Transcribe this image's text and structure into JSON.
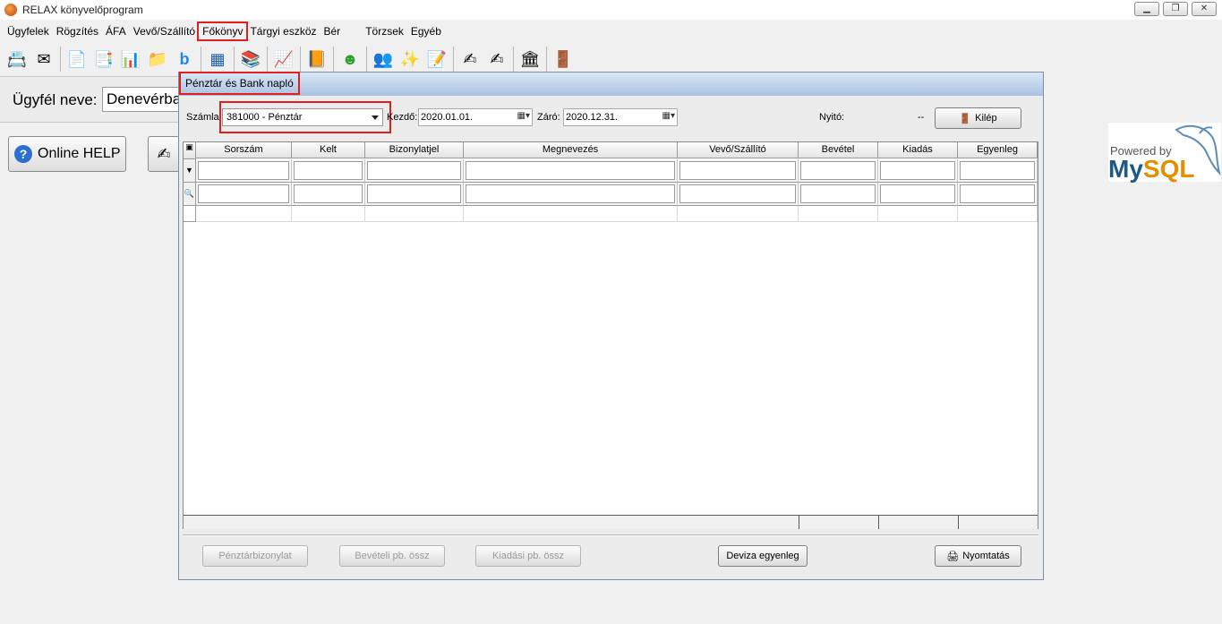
{
  "window": {
    "title": "RELAX könyvelőprogram",
    "minimize": "▁",
    "restore": "❐",
    "close": "✕"
  },
  "menu": {
    "items": [
      "Ügyfelek",
      "Rögzítés",
      "ÁFA",
      "Vevő/Szállító",
      "Főkönyv",
      "Tárgyi eszköz",
      "Bér",
      "Törzsek",
      "Egyéb"
    ]
  },
  "toolbar": {
    "icons": [
      "📇",
      "✉",
      "📄",
      "📑",
      "📊",
      "📁",
      "b",
      "▦",
      "📚",
      "📈",
      "📙",
      "☻",
      "👥",
      "✨",
      "📝",
      "✍",
      "✍",
      "🏛",
      "🚪"
    ]
  },
  "customer": {
    "label": "Ügyfél neve:",
    "value": "Denevérba"
  },
  "help": {
    "label": "Online HELP",
    "icon": "?"
  },
  "mysql": {
    "powered": "Powered by",
    "my": "My",
    "sql": "SQL"
  },
  "dialog": {
    "title": "Pénztár és Bank napló",
    "filters": {
      "account_label": "Számla",
      "account_value": "381000 - Pénztár",
      "start_label": "Kezdő:",
      "start_value": "2020.01.01.",
      "end_label": "Záró:",
      "end_value": "2020.12.31.",
      "opening_label": "Nyitó:",
      "opening_value": "--",
      "exit_label": "Kilép"
    },
    "grid": {
      "columns": [
        "Sorszám",
        "Kelt",
        "Bizonylatjel",
        "Megnevezés",
        "Vevő/Szállító",
        "Bevétel",
        "Kiadás",
        "Egyenleg"
      ],
      "filter_marker": "▼",
      "search_marker": "🔍",
      "corner_marker": "▣"
    },
    "buttons": {
      "cash_receipt": "Pénztárbizonylat",
      "income_total": "Bevételi pb. össz",
      "expense_total": "Kiadási pb. össz",
      "currency_balance": "Deviza egyenleg",
      "print": "Nyomtatás"
    }
  }
}
